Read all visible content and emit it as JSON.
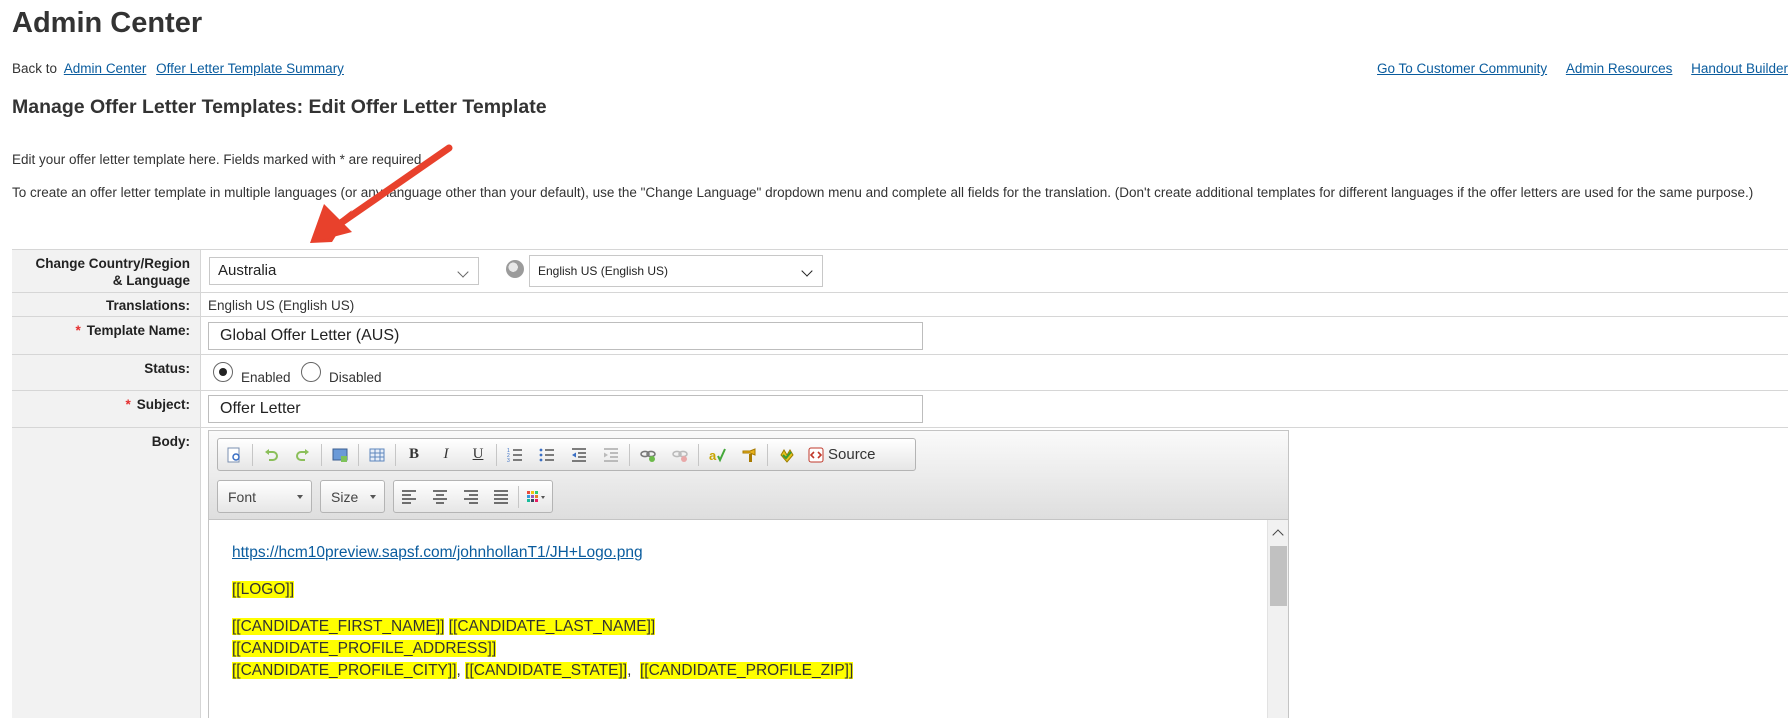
{
  "header": {
    "title": "Admin Center",
    "back_text": "Back to",
    "back_links": [
      "Admin Center",
      "Offer Letter Template Summary"
    ],
    "top_links": [
      "Go To Customer Community",
      "Admin Resources",
      "Handout Builder"
    ]
  },
  "page": {
    "subtitle": "Manage Offer Letter Templates: Edit Offer Letter Template",
    "instruction_1": "Edit your offer letter template here. Fields marked with * are required.",
    "instruction_2": "To create an offer letter template in multiple languages (or any language other than your default), use the \"Change Language\" dropdown menu and complete all fields for the translation. (Don't create additional templates for different languages if the offer letters are used for the same purpose.)"
  },
  "form": {
    "country_label_line1": "Change Country/Region",
    "country_label_line2": "& Language",
    "country_value": "Australia",
    "language_value": "English US (English US)",
    "translations_label": "Translations:",
    "translations_value": "English US (English US)",
    "required_marker": "*",
    "template_name_label": "Template Name:",
    "template_name_value": "Global Offer Letter (AUS)",
    "status_label": "Status:",
    "status_enabled": "Enabled",
    "status_disabled": "Disabled",
    "status_selected": "Enabled",
    "subject_label": "Subject:",
    "subject_value": "Offer Letter",
    "body_label": "Body:"
  },
  "editor": {
    "toolbar_source_label": "Source",
    "font_combo": "Font",
    "size_combo": "Size",
    "icons": [
      "preview-icon",
      "undo-icon",
      "redo-icon",
      "image-icon",
      "table-icon",
      "bold-icon",
      "italic-icon",
      "underline-icon",
      "numbered-list-icon",
      "bulleted-list-icon",
      "outdent-icon",
      "indent-icon",
      "link-icon",
      "unlink-icon",
      "spellcheck-icon",
      "paste-icon",
      "insert-field-icon",
      "source-icon",
      "align-left-icon",
      "align-center-icon",
      "align-right-icon",
      "justify-icon",
      "color-icon"
    ],
    "content": {
      "logo_url": "https://hcm10preview.sapsf.com/johnhollanT1/JH+Logo.png",
      "logo_token": "[[LOGO]]",
      "first_name": "[[CANDIDATE_FIRST_NAME]]",
      "last_name": "[[CANDIDATE_LAST_NAME]]",
      "address": "[[CANDIDATE_PROFILE_ADDRESS]]",
      "city": "[[CANDIDATE_PROFILE_CITY]]",
      "state": "[[CANDIDATE_STATE]]",
      "zip": "[[CANDIDATE_PROFILE_ZIP]]"
    }
  },
  "colors": {
    "link": "#0a5c9e",
    "required": "#e52e2e",
    "annotation_arrow": "#e8412c",
    "highlight": "#ffff00"
  }
}
